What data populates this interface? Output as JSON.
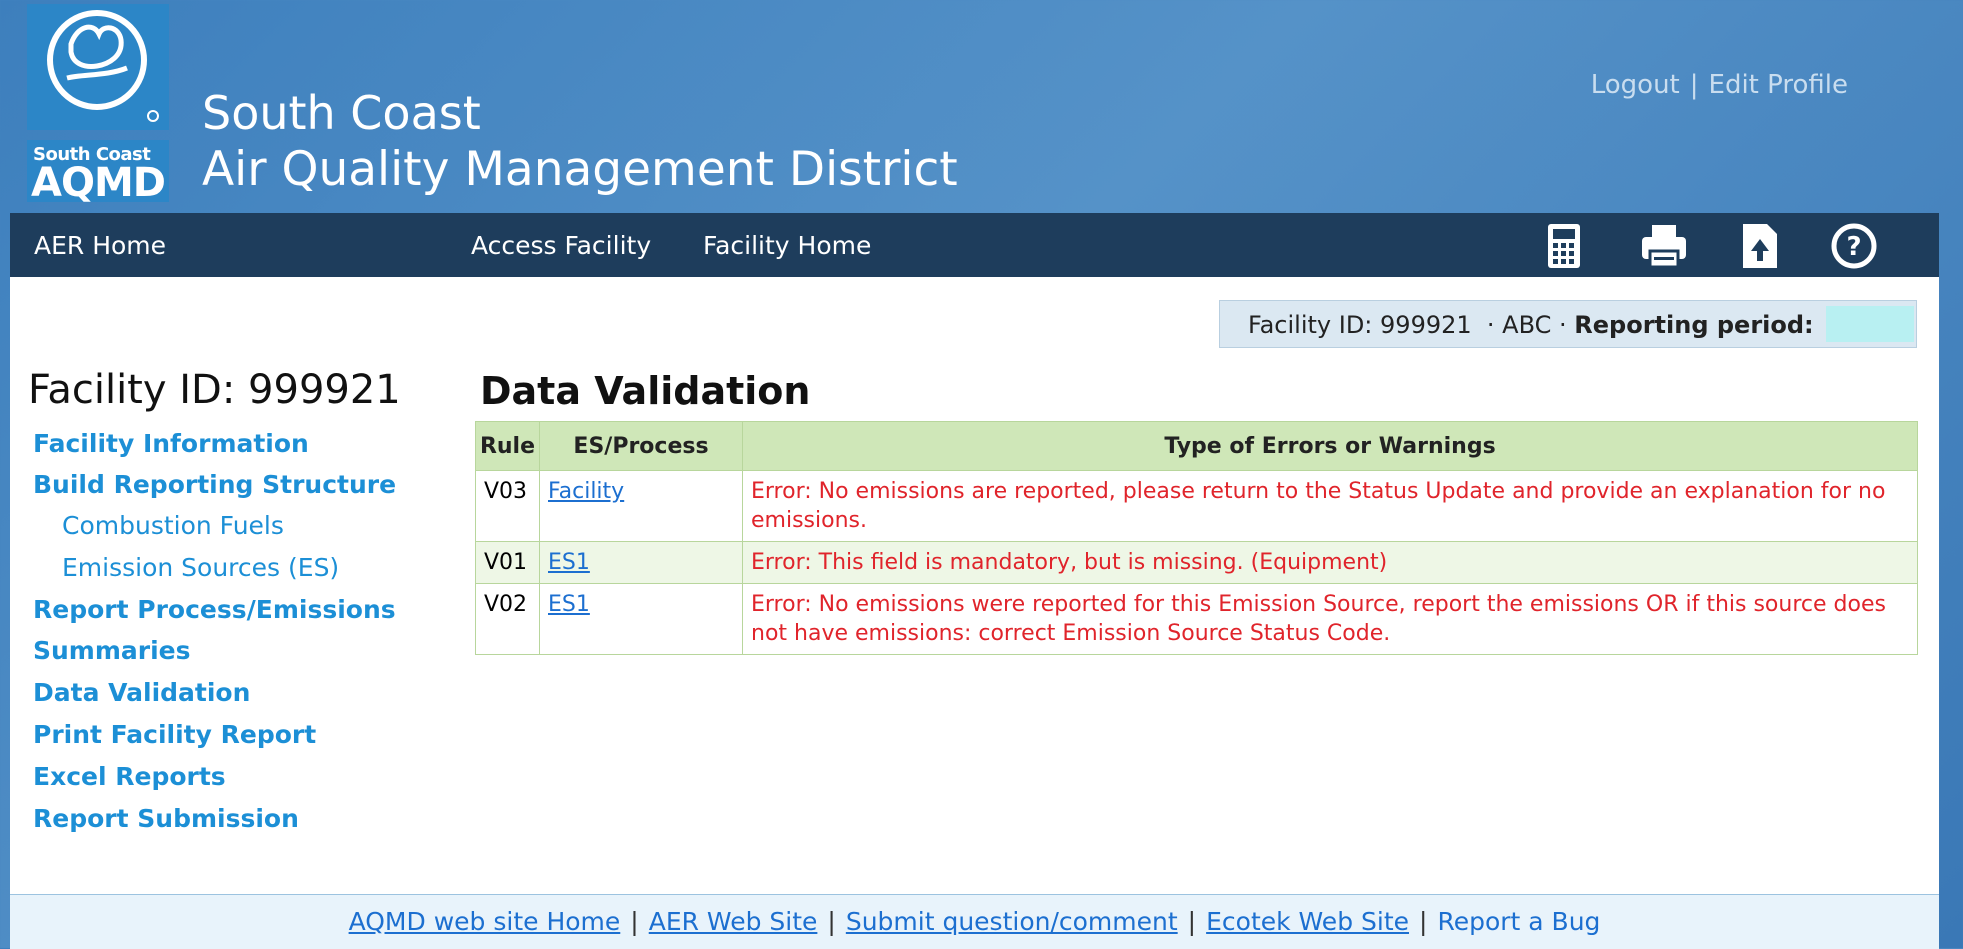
{
  "header": {
    "logo_small": "South Coast",
    "logo_big": "AQMD",
    "title_line1": "South Coast",
    "title_line2": "Air Quality Management District",
    "logout": "Logout",
    "separator": "|",
    "edit_profile": "Edit Profile"
  },
  "nav": {
    "aer_home": "AER Home",
    "access_facility": "Access Facility",
    "facility_home": "Facility Home",
    "icons": [
      "calculator-icon",
      "printer-icon",
      "upload-icon",
      "help-icon"
    ]
  },
  "facility_bar": {
    "facility_id": "Facility ID: 999921",
    "name": "· ABC ·",
    "period_label": "Reporting period:",
    "period_value": ""
  },
  "sidebar": {
    "title": "Facility ID: 999921",
    "items": [
      {
        "label": "Facility Information"
      },
      {
        "label": "Build Reporting Structure"
      },
      {
        "label": "Combustion Fuels"
      },
      {
        "label": "Emission Sources (ES)"
      },
      {
        "label": "Report Process/Emissions"
      },
      {
        "label": "Summaries"
      },
      {
        "label": "Data Validation"
      },
      {
        "label": "Print Facility Report"
      },
      {
        "label": "Excel Reports"
      },
      {
        "label": "Report Submission"
      }
    ]
  },
  "main": {
    "title": "Data Validation",
    "table": {
      "headers": [
        "Rule",
        "ES/Process",
        "Type of Errors or Warnings"
      ],
      "rows": [
        {
          "rule": "V03",
          "process": "Facility",
          "message": "Error: No emissions are reported, please return to the Status Update and provide an explanation for no emissions."
        },
        {
          "rule": "V01",
          "process": "ES1",
          "message": "Error: This field is mandatory, but is missing. (Equipment)"
        },
        {
          "rule": "V02",
          "process": "ES1",
          "message": "Error: No emissions were reported for this Emission Source, report the emissions OR if this source does not have emissions: correct Emission Source Status Code."
        }
      ]
    }
  },
  "footer": {
    "links": [
      "AQMD web site Home",
      "AER Web Site",
      "Submit question/comment",
      "Ecotek Web Site",
      "Report a Bug"
    ],
    "separator": "|"
  },
  "colors": {
    "header_bg": "#3d7fbd",
    "nav_bg": "#1e3d5c",
    "link": "#1c8fd6",
    "error": "#e0242b",
    "table_header": "#cfe7b8"
  }
}
